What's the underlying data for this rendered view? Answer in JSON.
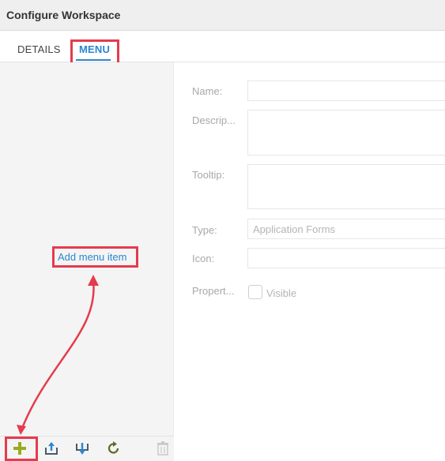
{
  "window": {
    "title": "Configure Workspace"
  },
  "tabs": [
    {
      "label": "DETAILS",
      "active": false
    },
    {
      "label": "MENU",
      "active": true
    }
  ],
  "left_pane": {
    "add_menu_item_label": "Add menu item",
    "toolbar": [
      {
        "name": "add-icon"
      },
      {
        "name": "export-icon"
      },
      {
        "name": "import-icon"
      },
      {
        "name": "refresh-icon"
      },
      {
        "name": "delete-icon",
        "disabled": true
      }
    ]
  },
  "form": {
    "name_label": "Name:",
    "name_value": "",
    "description_label": "Descrip...",
    "description_value": "",
    "tooltip_label": "Tooltip:",
    "tooltip_value": "",
    "type_label": "Type:",
    "type_value": "Application Forms",
    "icon_label": "Icon:",
    "icon_value": "",
    "properties_label": "Propert...",
    "visible_label": "Visible",
    "visible_checked": false
  },
  "colors": {
    "accent": "#2b87d1",
    "highlight": "#e53b4d",
    "add_icon": "#9aab1e"
  }
}
